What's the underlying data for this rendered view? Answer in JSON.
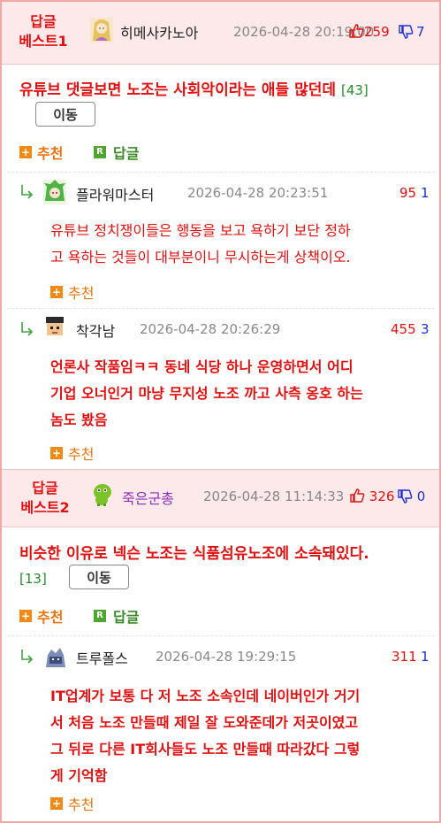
{
  "best1": {
    "label_line1": "답글",
    "label_line2": "베스트1",
    "nick": "히메사카노아",
    "timestamp": "2026-04-28 20:19:00",
    "up": "259",
    "down": "7",
    "text": "유튜브 댓글보면 노조는 사회악이라는 애들 많던데",
    "count": "[43]",
    "move_label": "이동",
    "recommend_label": "추천",
    "reply_label": "답글"
  },
  "reply1": {
    "nick": "플라워마스터",
    "timestamp": "2026-04-28 20:23:51",
    "up": "95",
    "down": "1",
    "text_lines": [
      "유튜브 정치쟁이들은 행동을 보고 욕하기 보단 정하",
      "고 욕하는 것들이 대부분이니 무시하는게 상책이오."
    ],
    "recommend_label": "추천"
  },
  "reply2": {
    "nick": "착각남",
    "timestamp": "2026-04-28 20:26:29",
    "up": "455",
    "down": "3",
    "text_lines": [
      "언론사 작품임ㅋㅋ 동네 식당 하나 운영하면서 어디",
      "기업 오너인거 마냥 무지성 노조 까고 사측 옹호 하는",
      "놈도 봤음"
    ],
    "recommend_label": "추천"
  },
  "best2": {
    "label_line1": "답글",
    "label_line2": "베스트2",
    "nick": "죽은군총",
    "timestamp": "2026-04-28 11:14:33",
    "up": "326",
    "down": "0",
    "text": "비슷한 이유로 넥슨 노조는 식품섬유노조에 소속돼있다.",
    "count": "[13]",
    "move_label": "이동",
    "recommend_label": "추천",
    "reply_label": "답글"
  },
  "reply3": {
    "nick": "트루폴스",
    "timestamp": "2026-04-28 19:29:15",
    "up": "311",
    "down": "1",
    "text_lines": [
      "IT업계가 보통 다 저 노조 소속인데 네이버인가 거기",
      "서 처음 노조 만들때 제일 잘 도와준데가 저곳이였고",
      "그 뒤로 다른 IT회사들도 노조 만들때 따라갔다 그렇",
      "게 기억함"
    ],
    "recommend_label": "추천"
  },
  "colors": {
    "accent_red": "#e01010",
    "down_blue": "#1a2fd6",
    "recommend_orange": "#e8730c",
    "reply_green": "#4fa52f",
    "best_bg": "#fde8ea"
  }
}
